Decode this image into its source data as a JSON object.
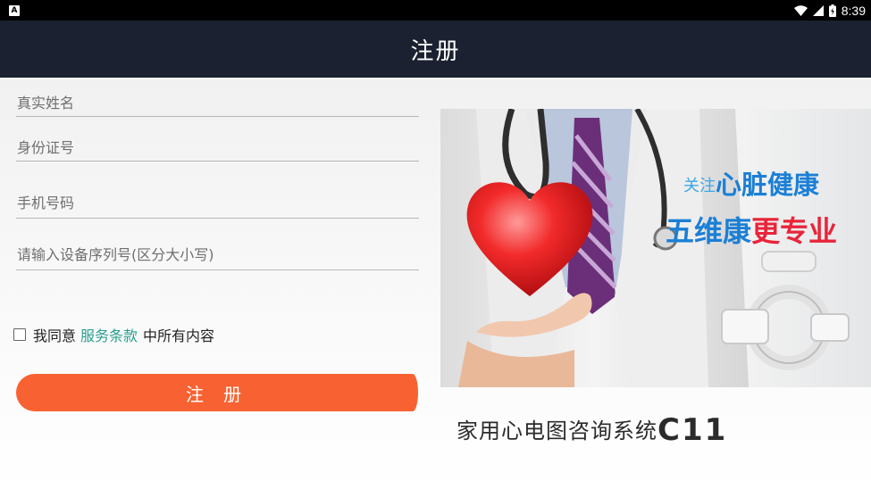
{
  "status_bar": {
    "notification_icon": "A",
    "time": "8:39",
    "icons": [
      "wifi-icon",
      "signal-icon",
      "battery-icon"
    ]
  },
  "header": {
    "title": "注册"
  },
  "form": {
    "name_placeholder": "真实姓名",
    "id_placeholder": "身份证号",
    "phone_placeholder": "手机号码",
    "serial_placeholder": "请输入设备序列号(区分大小写)",
    "agree_prefix": "我同意",
    "terms_link": "服务条款",
    "agree_suffix": "中所有内容",
    "register_button": "注 册"
  },
  "banner": {
    "slogan_prefix": "关注",
    "slogan_main": "心脏健康",
    "slogan2_blue": "五维康",
    "slogan2_red": "更专业",
    "product_name": "家用心电图咨询系统",
    "product_model": "C11"
  },
  "colors": {
    "header_bg": "#1b2130",
    "button": "#f86232",
    "link": "#2a9d8f",
    "slogan_blue": "#1b7fd6",
    "slogan_red": "#e9253a"
  }
}
